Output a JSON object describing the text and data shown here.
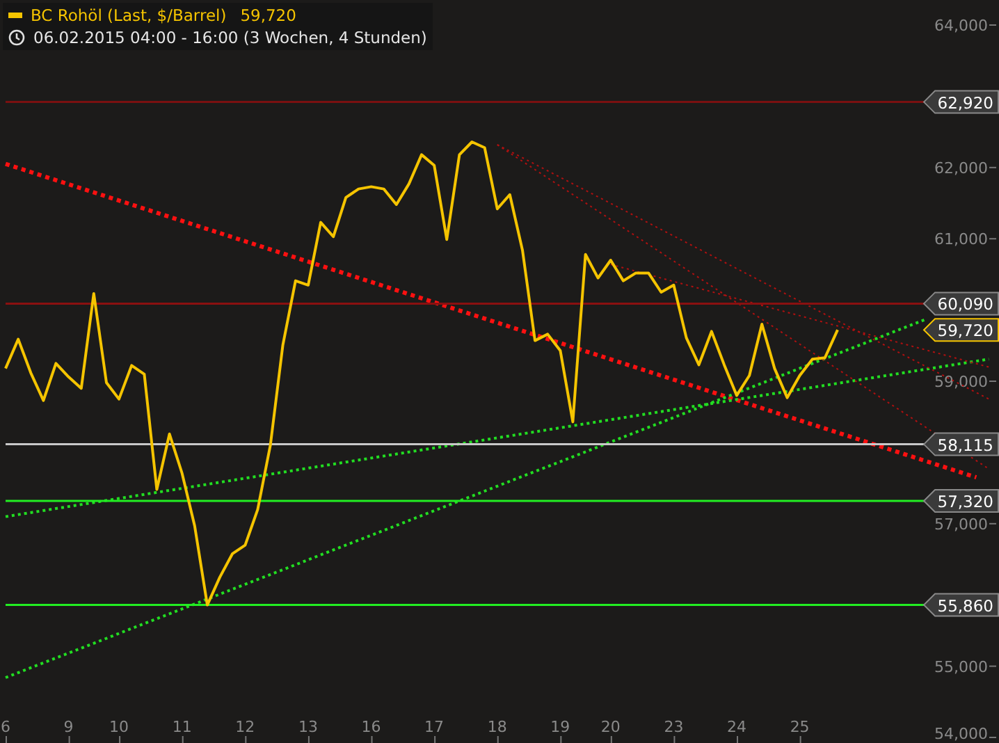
{
  "header": {
    "last_value": "59,720",
    "period": "06.02.2015 04:00 - 16:00 (3 Wochen, 4 Stunden)"
  },
  "chart": {
    "chart_data": {
      "type": "line",
      "ylim": [
        54000,
        64000
      ],
      "categories": [
        "6",
        null,
        null,
        null,
        null,
        "9",
        null,
        null,
        null,
        "10",
        null,
        null,
        null,
        null,
        "11",
        null,
        null,
        null,
        null,
        "12",
        null,
        null,
        null,
        null,
        "13",
        null,
        null,
        null,
        null,
        "16",
        null,
        null,
        null,
        null,
        "17",
        null,
        null,
        null,
        null,
        "18",
        null,
        null,
        null,
        null,
        "19",
        null,
        null,
        null,
        "20",
        null,
        null,
        null,
        null,
        "23",
        null,
        null,
        null,
        null,
        "24",
        null,
        null,
        null,
        null,
        "25",
        null,
        null,
        null,
        null,
        null,
        null,
        null,
        null,
        null,
        null,
        null,
        null,
        null,
        null,
        null
      ],
      "series": [
        {
          "name": "BC Rohöl (Last, $/Barrel)",
          "color": "#f5c400",
          "values": [
            59180,
            59590,
            59120,
            58730,
            59250,
            59060,
            58900,
            60230,
            58980,
            58750,
            59220,
            59100,
            57480,
            58260,
            57710,
            56970,
            55860,
            56250,
            56580,
            56700,
            57200,
            58100,
            59510,
            60410,
            60350,
            61230,
            61030,
            61580,
            61700,
            61730,
            61700,
            61480,
            61770,
            62180,
            62030,
            60990,
            62180,
            62360,
            62280,
            61420,
            61620,
            60840,
            59570,
            59660,
            59430,
            58430,
            60780,
            60450,
            60700,
            60410,
            60520,
            60520,
            60250,
            60350,
            59610,
            59230,
            59700,
            59230,
            58800,
            59080,
            59800,
            59180,
            58770,
            59080,
            59310,
            59330,
            59720,
            null,
            null,
            null,
            null,
            null,
            null,
            null,
            null,
            null,
            null,
            null,
            null
          ]
        },
        {
          "color": "#ff1010",
          "line_style": "dotted",
          "values": [
            62050,
            null,
            null,
            null,
            null,
            null,
            null,
            null,
            null,
            null,
            null,
            null,
            null,
            null,
            null,
            null,
            null,
            null,
            null,
            null,
            null,
            null,
            null,
            null,
            null,
            null,
            null,
            null,
            null,
            null,
            null,
            null,
            null,
            null,
            null,
            null,
            null,
            null,
            null,
            null,
            null,
            null,
            null,
            null,
            null,
            null,
            null,
            null,
            null,
            null,
            null,
            null,
            null,
            null,
            null,
            null,
            null,
            null,
            null,
            null,
            null,
            null,
            null,
            null,
            null,
            null,
            null,
            null,
            null,
            null,
            null,
            null,
            null,
            null,
            null,
            null,
            null,
            57650,
            null
          ]
        },
        {
          "color": "#22dd22",
          "line_style": "dotted",
          "values": [
            54840,
            null,
            null,
            null,
            null,
            null,
            null,
            null,
            null,
            null,
            null,
            null,
            null,
            null,
            null,
            null,
            null,
            null,
            null,
            null,
            null,
            null,
            null,
            null,
            null,
            null,
            null,
            null,
            null,
            null,
            null,
            null,
            null,
            null,
            null,
            null,
            null,
            null,
            null,
            null,
            null,
            null,
            null,
            null,
            null,
            null,
            null,
            null,
            null,
            null,
            null,
            null,
            null,
            null,
            null,
            null,
            null,
            null,
            null,
            null,
            null,
            null,
            null,
            null,
            null,
            null,
            null,
            null,
            null,
            null,
            null,
            null,
            null,
            59870,
            null,
            null,
            null,
            null,
            null
          ]
        },
        {
          "color": "#22dd22",
          "line_style": "dotted",
          "values": [
            57100,
            null,
            null,
            null,
            null,
            null,
            null,
            null,
            null,
            null,
            null,
            null,
            null,
            null,
            null,
            null,
            null,
            null,
            null,
            null,
            null,
            null,
            null,
            null,
            null,
            null,
            null,
            null,
            null,
            null,
            null,
            null,
            null,
            null,
            null,
            null,
            null,
            null,
            null,
            null,
            null,
            null,
            null,
            null,
            null,
            null,
            null,
            null,
            null,
            null,
            null,
            null,
            null,
            null,
            null,
            null,
            null,
            null,
            null,
            null,
            null,
            null,
            null,
            null,
            null,
            null,
            null,
            null,
            null,
            null,
            null,
            null,
            null,
            null,
            null,
            null,
            null,
            null,
            59310
          ]
        },
        {
          "color": "#b01010",
          "values": [
            null,
            null,
            null,
            null,
            null,
            null,
            null,
            null,
            null,
            null,
            null,
            null,
            null,
            null,
            null,
            null,
            null,
            null,
            null,
            null,
            null,
            null,
            null,
            null,
            null,
            null,
            null,
            null,
            null,
            null,
            null,
            null,
            null,
            null,
            null,
            null,
            null,
            null,
            null,
            62320,
            null,
            null,
            null,
            null,
            null,
            null,
            null,
            null,
            null,
            null,
            null,
            null,
            null,
            null,
            null,
            null,
            null,
            null,
            null,
            null,
            null,
            null,
            null,
            null,
            null,
            null,
            null,
            null,
            null,
            null,
            null,
            null,
            null,
            null,
            null,
            null,
            null,
            null,
            58750
          ],
          "line_style": "dotted"
        },
        {
          "color": "#b01010",
          "values": [
            null,
            null,
            null,
            null,
            null,
            null,
            null,
            null,
            null,
            null,
            null,
            null,
            null,
            null,
            null,
            null,
            null,
            null,
            null,
            null,
            null,
            null,
            null,
            null,
            null,
            null,
            null,
            null,
            null,
            null,
            null,
            null,
            null,
            null,
            null,
            null,
            null,
            null,
            null,
            62320,
            null,
            null,
            null,
            null,
            null,
            null,
            null,
            null,
            null,
            null,
            null,
            null,
            null,
            null,
            null,
            null,
            null,
            null,
            null,
            null,
            null,
            null,
            null,
            null,
            null,
            null,
            null,
            null,
            null,
            null,
            null,
            null,
            null,
            null,
            null,
            null,
            null,
            null,
            57770
          ],
          "line_style": "dotted"
        },
        {
          "color": "#b01010",
          "values": [
            null,
            null,
            null,
            null,
            null,
            null,
            null,
            null,
            null,
            null,
            null,
            null,
            null,
            null,
            null,
            null,
            null,
            null,
            null,
            null,
            null,
            null,
            null,
            null,
            null,
            null,
            null,
            null,
            null,
            null,
            null,
            null,
            null,
            null,
            null,
            null,
            null,
            null,
            null,
            null,
            null,
            null,
            null,
            null,
            null,
            null,
            null,
            null,
            60640,
            null,
            null,
            null,
            null,
            null,
            null,
            null,
            null,
            null,
            null,
            null,
            null,
            null,
            null,
            null,
            null,
            null,
            null,
            null,
            null,
            null,
            null,
            null,
            null,
            null,
            null,
            null,
            null,
            null,
            59200
          ],
          "line_style": "dotted"
        },
        {
          "color": "#7a1010",
          "values": [
            62920,
            null,
            null,
            null,
            null,
            null,
            null,
            null,
            null,
            null,
            null,
            null,
            null,
            null,
            null,
            null,
            null,
            null,
            null,
            null,
            null,
            null,
            null,
            null,
            null,
            null,
            null,
            null,
            null,
            null,
            null,
            null,
            null,
            null,
            null,
            null,
            null,
            null,
            null,
            null,
            null,
            null,
            null,
            null,
            null,
            null,
            null,
            null,
            null,
            null,
            null,
            null,
            null,
            null,
            null,
            null,
            null,
            null,
            null,
            null,
            null,
            null,
            null,
            null,
            null,
            null,
            null,
            null,
            null,
            null,
            null,
            null,
            null,
            62920,
            null,
            null,
            null,
            null,
            null
          ]
        },
        {
          "color": "#8a1010",
          "values": [
            60090,
            null,
            null,
            null,
            null,
            null,
            null,
            null,
            null,
            null,
            null,
            null,
            null,
            null,
            null,
            null,
            null,
            null,
            null,
            null,
            null,
            null,
            null,
            null,
            null,
            null,
            null,
            null,
            null,
            null,
            null,
            null,
            null,
            null,
            null,
            null,
            null,
            null,
            null,
            null,
            null,
            null,
            null,
            null,
            null,
            null,
            null,
            null,
            null,
            null,
            null,
            null,
            null,
            null,
            null,
            null,
            null,
            null,
            null,
            null,
            null,
            null,
            null,
            null,
            null,
            null,
            null,
            null,
            null,
            null,
            null,
            null,
            null,
            60090,
            null,
            null,
            null,
            null,
            null
          ]
        },
        {
          "color": "#c8c8c8",
          "values": [
            58115,
            null,
            null,
            null,
            null,
            null,
            null,
            null,
            null,
            null,
            null,
            null,
            null,
            null,
            null,
            null,
            null,
            null,
            null,
            null,
            null,
            null,
            null,
            null,
            null,
            null,
            null,
            null,
            null,
            null,
            null,
            null,
            null,
            null,
            null,
            null,
            null,
            null,
            null,
            null,
            null,
            null,
            null,
            null,
            null,
            null,
            null,
            null,
            null,
            null,
            null,
            null,
            null,
            null,
            null,
            null,
            null,
            null,
            null,
            null,
            null,
            null,
            null,
            null,
            null,
            null,
            null,
            null,
            null,
            null,
            null,
            null,
            null,
            58115,
            null,
            null,
            null,
            null,
            null
          ]
        },
        {
          "color": "#22ee22",
          "values": [
            57320,
            null,
            null,
            null,
            null,
            null,
            null,
            null,
            null,
            null,
            null,
            null,
            null,
            null,
            null,
            null,
            null,
            null,
            null,
            null,
            null,
            null,
            null,
            null,
            null,
            null,
            null,
            null,
            null,
            null,
            null,
            null,
            null,
            null,
            null,
            null,
            null,
            null,
            null,
            null,
            null,
            null,
            null,
            null,
            null,
            null,
            null,
            null,
            null,
            null,
            null,
            null,
            null,
            null,
            null,
            null,
            null,
            null,
            null,
            null,
            null,
            null,
            null,
            null,
            null,
            null,
            null,
            null,
            null,
            null,
            null,
            null,
            null,
            57320,
            null,
            null,
            null,
            null,
            null
          ]
        },
        {
          "color": "#22ee22",
          "values": [
            55860,
            null,
            null,
            null,
            null,
            null,
            null,
            null,
            null,
            null,
            null,
            null,
            null,
            null,
            null,
            null,
            null,
            null,
            null,
            null,
            null,
            null,
            null,
            null,
            null,
            null,
            null,
            null,
            null,
            null,
            null,
            null,
            null,
            null,
            null,
            null,
            null,
            null,
            null,
            null,
            null,
            null,
            null,
            null,
            null,
            null,
            null,
            null,
            null,
            null,
            null,
            null,
            null,
            null,
            null,
            null,
            null,
            null,
            null,
            null,
            null,
            null,
            null,
            null,
            null,
            null,
            null,
            null,
            null,
            null,
            null,
            null,
            null,
            55860,
            null,
            null,
            null,
            null,
            null
          ]
        }
      ],
      "yticks": [
        {
          "value": 64000,
          "label": "64,000"
        },
        {
          "value": 62000,
          "label": "62,000"
        },
        {
          "value": 61000,
          "label": "61,000"
        },
        {
          "value": 59000,
          "label": "59,000"
        },
        {
          "value": 57000,
          "label": "57,000"
        },
        {
          "value": 55000,
          "label": "55,000"
        },
        {
          "value": 54000,
          "label": "54,000"
        }
      ]
    },
    "price_labels": [
      {
        "kind": "level",
        "label": "62,920"
      },
      {
        "kind": "level",
        "label": "60,090"
      },
      {
        "kind": "last",
        "label": "59,720"
      },
      {
        "kind": "level",
        "label": "58,115"
      },
      {
        "kind": "level",
        "label": "57,320"
      },
      {
        "kind": "level",
        "label": "55,860"
      }
    ]
  }
}
